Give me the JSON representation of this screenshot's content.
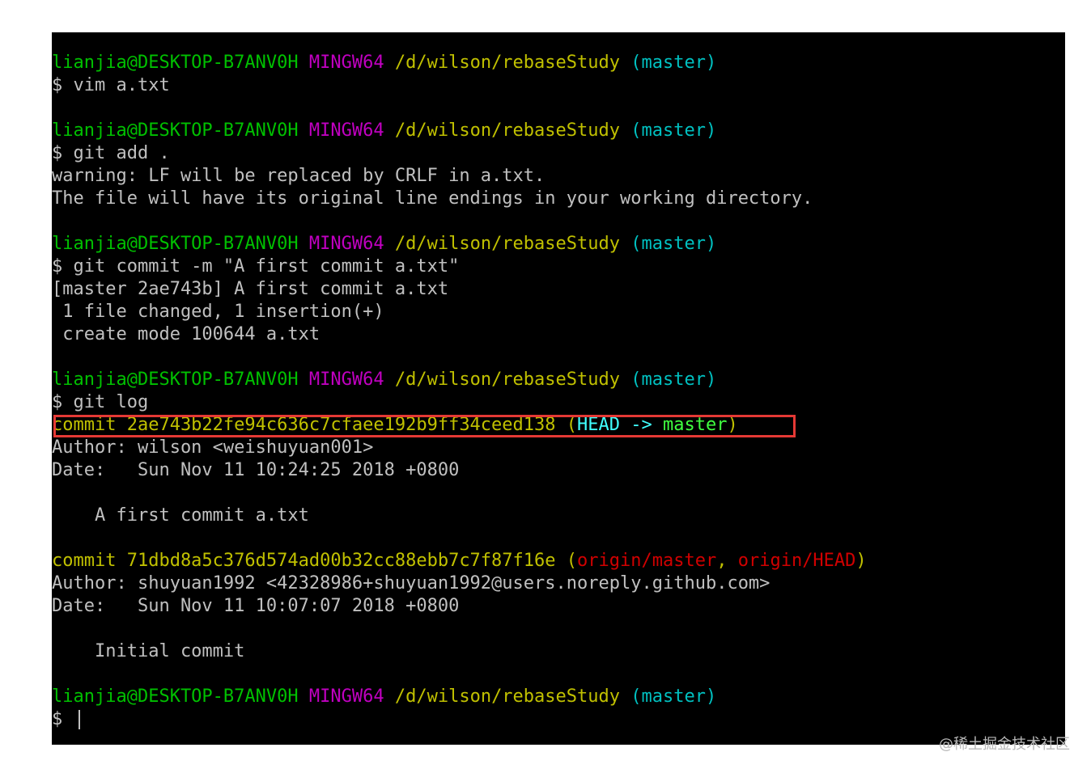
{
  "prompt": {
    "user_host": "lianjia@DESKTOP-B7ANV0H",
    "system": "MINGW64",
    "path": "/d/wilson/rebaseStudy",
    "branch": "(master)"
  },
  "commands": {
    "vim": "$ vim a.txt",
    "add": "$ git add .",
    "commit": "$ git commit -m \"A first commit a.txt\"",
    "log": "$ git log",
    "empty": "$ "
  },
  "output": {
    "warning": "warning: LF will be replaced by CRLF in a.txt.",
    "line_endings": "The file will have its original line endings in your working directory.",
    "commit_result": "[master 2ae743b] A first commit a.txt",
    "files_changed": " 1 file changed, 1 insertion(+)",
    "create_mode": " create mode 100644 a.txt"
  },
  "log": {
    "commit1": {
      "commit": "commit 2ae743b22fe94c636c7cfaee192b9ff34ceed138",
      "open_paren": " (",
      "head": "HEAD -> ",
      "master": "master",
      "close_paren": ")",
      "author": "Author: wilson <weishuyuan001>",
      "date": "Date:   Sun Nov 11 10:24:25 2018 +0800",
      "message": "    A first commit a.txt"
    },
    "commit2": {
      "commit": "commit 71dbd8a5c376d574ad00b32cc88ebb7c7f87f16e",
      "open_paren": " (",
      "origin_master": "origin/master",
      "comma": ", ",
      "origin_head": "origin/HEAD",
      "close_paren": ")",
      "author": "Author: shuyuan1992 <42328986+shuyuan1992@users.noreply.github.com>",
      "date": "Date:   Sun Nov 11 10:07:07 2018 +0800",
      "message": "    Initial commit"
    }
  },
  "watermark": "@稀土掘金技术社区",
  "colors": {
    "background": "#000000",
    "highlight_border": "#e53935"
  }
}
